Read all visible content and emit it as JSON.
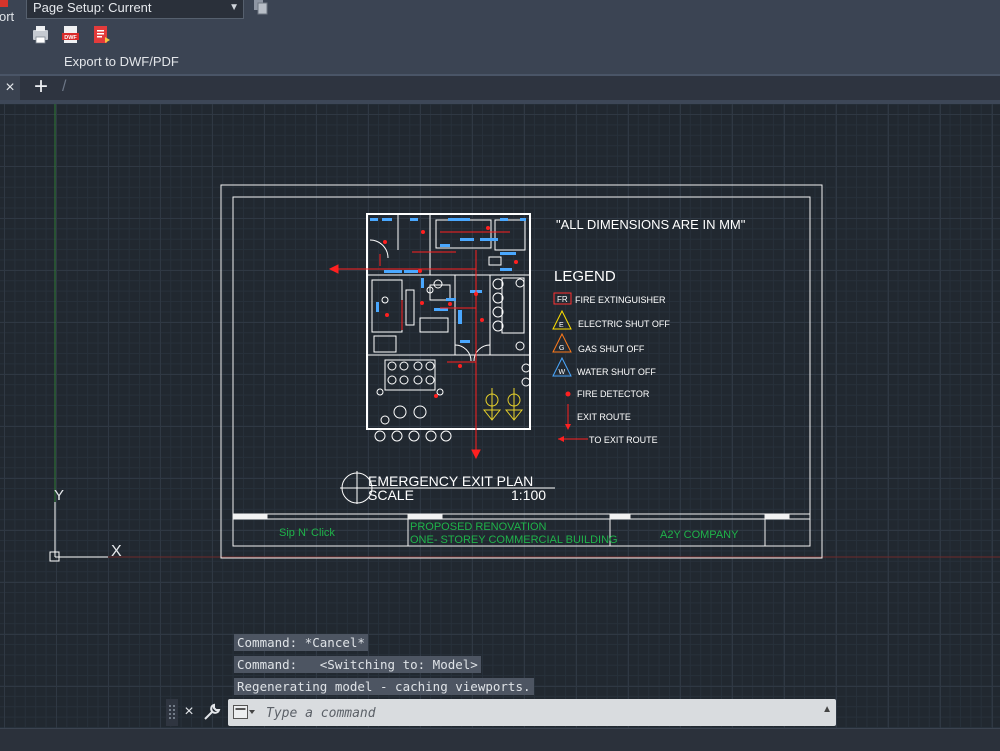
{
  "ribbon": {
    "clipped_label": "ort",
    "page_setup": "Page Setup: Current",
    "export_label": "Export to DWF/PDF",
    "icons": [
      "page-setup-manager-icon",
      "batch-plot-icon",
      "export-dwf-icon",
      "export-pdf-icon"
    ]
  },
  "tabs": {
    "close": "×",
    "add": "+"
  },
  "drawing": {
    "note": "\"ALL DIMENSIONS ARE IN MM\"",
    "legend_title": "LEGEND",
    "legend": [
      {
        "symbol": "FR",
        "label": "FIRE EXTINGUISHER",
        "color": "#ff3030"
      },
      {
        "symbol": "E",
        "label": "ELECTRIC SHUT OFF",
        "color": "#ffe000"
      },
      {
        "symbol": "G",
        "label": "GAS SHUT OFF",
        "color": "#ff7a1a"
      },
      {
        "symbol": "W",
        "label": "WATER SHUT OFF",
        "color": "#4aa8ff"
      },
      {
        "symbol": "",
        "label": "FIRE DETECTOR",
        "color": "#ff2020"
      },
      {
        "symbol": "",
        "label": "EXIT ROUTE",
        "color": "#ff2020"
      },
      {
        "symbol": "",
        "label": "TO EXIT ROUTE",
        "color": "#ff2020"
      }
    ],
    "plan_title": "EMERGENCY EXIT PLAN",
    "scale_label": "SCALE",
    "scale_value": "1:100",
    "titleblock": {
      "owner": "Sip N' Click",
      "project_line1": "PROPOSED RENOVATION",
      "project_line2": "ONE- STOREY COMMERCIAL BUILDING",
      "company": "A2Y COMPANY"
    },
    "ucs_y": "Y",
    "ucs_x": "X"
  },
  "command": {
    "history": [
      "Command: *Cancel*",
      "Command:   <Switching to: Model>",
      "Regenerating model - caching viewports."
    ],
    "close": "×",
    "placeholder": "Type a command"
  },
  "colors": {
    "ribbon": "#3b4453",
    "canvas": "#212830",
    "titleblock_text": "#1fb34a"
  }
}
